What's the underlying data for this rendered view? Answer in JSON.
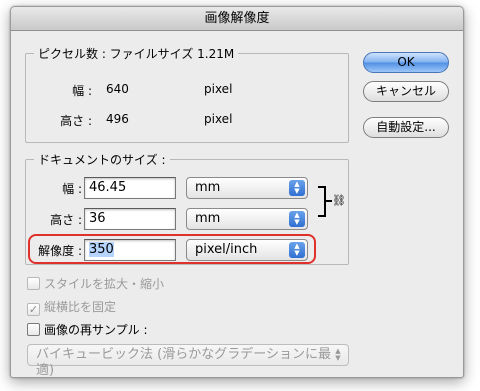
{
  "dialog": {
    "title": "画像解像度"
  },
  "pixel_dimensions": {
    "legend": "ピクセル数 : ファイルサイズ 1.21M",
    "width": {
      "label": "幅 :",
      "value": "640",
      "unit": "pixel"
    },
    "height": {
      "label": "高さ :",
      "value": "496",
      "unit": "pixel"
    }
  },
  "document_size": {
    "legend": "ドキュメントのサイズ :",
    "width": {
      "label": "幅 :",
      "value": "46.45",
      "unit": "mm"
    },
    "height": {
      "label": "高さ :",
      "value": "36",
      "unit": "mm"
    },
    "resolution": {
      "label": "解像度 :",
      "value": "350",
      "unit": "pixel/inch"
    },
    "link_icon": "chain-link-icon"
  },
  "buttons": {
    "ok": "OK",
    "cancel": "キャンセル",
    "auto": "自動設定..."
  },
  "options": {
    "scale_styles": {
      "label": "スタイルを拡大・縮小",
      "checked": false,
      "enabled": false
    },
    "constrain_proportions": {
      "label": "縦横比を固定",
      "checked": true,
      "enabled": false
    },
    "resample": {
      "label": "画像の再サンプル :",
      "checked": false,
      "enabled": true
    }
  },
  "resample_method": {
    "value": "バイキュービック法 (滑らかなグラデーションに最適)",
    "enabled": false
  },
  "colors": {
    "highlight": "#e0302c",
    "default_button": "#4f8fe5",
    "selection": "#b5d5ff"
  }
}
